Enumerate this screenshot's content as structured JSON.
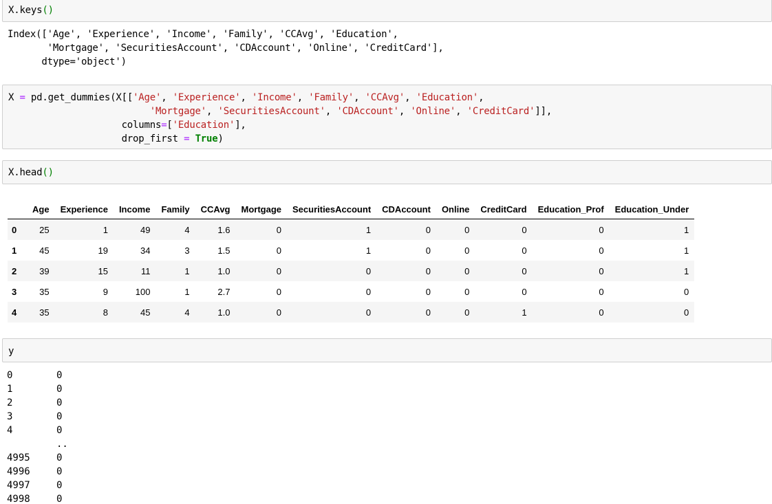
{
  "cells": {
    "keys": {
      "code": "X.keys",
      "paren": "()",
      "output": [
        "Index(['Age', 'Experience', 'Income', 'Family', 'CCAvg', 'Education',",
        "       'Mortgage', 'SecuritiesAccount', 'CDAccount', 'Online', 'CreditCard'],",
        "      dtype='object')"
      ]
    },
    "dummies": {
      "line1_a": "X ",
      "line1_eq": "=",
      "line1_b": " pd.get_dummies(X[[",
      "line1_s1": "'Age'",
      "line1_s2": "'Experience'",
      "line1_s3": "'Income'",
      "line1_s4": "'Family'",
      "line1_s5": "'CCAvg'",
      "line1_s6": "'Education'",
      "line2_s1": "'Mortgage'",
      "line2_s2": "'SecuritiesAccount'",
      "line2_s3": "'CDAccount'",
      "line2_s4": "'Online'",
      "line2_s5": "'CreditCard'",
      "line3_a": "columns",
      "line3_eq": "=",
      "line3_s": "'Education'",
      "line4_a": "drop_first ",
      "line4_eq": "=",
      "line4_k": "True"
    },
    "head": {
      "code": "X.head",
      "paren": "()"
    },
    "y": {
      "code": "y"
    }
  },
  "dataframe": {
    "columns": [
      "Age",
      "Experience",
      "Income",
      "Family",
      "CCAvg",
      "Mortgage",
      "SecuritiesAccount",
      "CDAccount",
      "Online",
      "CreditCard",
      "Education_Prof",
      "Education_Under"
    ],
    "rows": [
      {
        "index": "0",
        "values": [
          "25",
          "1",
          "49",
          "4",
          "1.6",
          "0",
          "1",
          "0",
          "0",
          "0",
          "0",
          "1"
        ]
      },
      {
        "index": "1",
        "values": [
          "45",
          "19",
          "34",
          "3",
          "1.5",
          "0",
          "1",
          "0",
          "0",
          "0",
          "0",
          "1"
        ]
      },
      {
        "index": "2",
        "values": [
          "39",
          "15",
          "11",
          "1",
          "1.0",
          "0",
          "0",
          "0",
          "0",
          "0",
          "0",
          "1"
        ]
      },
      {
        "index": "3",
        "values": [
          "35",
          "9",
          "100",
          "1",
          "2.7",
          "0",
          "0",
          "0",
          "0",
          "0",
          "0",
          "0"
        ]
      },
      {
        "index": "4",
        "values": [
          "35",
          "8",
          "45",
          "4",
          "1.0",
          "0",
          "0",
          "0",
          "0",
          "1",
          "0",
          "0"
        ]
      }
    ]
  },
  "series": [
    {
      "index": "0",
      "value": "0"
    },
    {
      "index": "1",
      "value": "0"
    },
    {
      "index": "2",
      "value": "0"
    },
    {
      "index": "3",
      "value": "0"
    },
    {
      "index": "4",
      "value": "0"
    },
    {
      "index": "",
      "value": ".."
    },
    {
      "index": "4995",
      "value": "0"
    },
    {
      "index": "4996",
      "value": "0"
    },
    {
      "index": "4997",
      "value": "0"
    },
    {
      "index": "4998",
      "value": "0"
    }
  ]
}
